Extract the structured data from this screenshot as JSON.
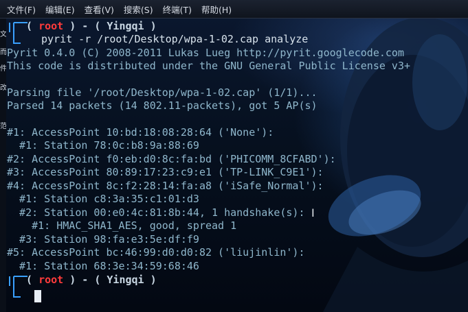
{
  "menu": [
    "文件(F)",
    "编辑(E)",
    "查看(V)",
    "搜索(S)",
    "终端(T)",
    "帮助(H)"
  ],
  "side_glyphs": [
    "文",
    "而",
    "件",
    "改",
    "范"
  ],
  "prompt": {
    "user": "root",
    "sep": " ) - ( ",
    "host": "Yingqi",
    "close": " )"
  },
  "command": "pyrit -r /root/Desktop/wpa-1-02.cap analyze",
  "output": [
    "Pyrit 0.4.0 (C) 2008-2011 Lukas Lueg http://pyrit.googlecode.com",
    "This code is distributed under the GNU General Public License v3+",
    "",
    "Parsing file '/root/Desktop/wpa-1-02.cap' (1/1)...",
    "Parsed 14 packets (14 802.11-packets), got 5 AP(s)",
    "",
    "#1: AccessPoint 10:bd:18:08:28:64 ('None'):",
    "  #1: Station 78:0c:b8:9a:88:69",
    "#2: AccessPoint f0:eb:d0:8c:fa:bd ('PHICOMM_8CFABD'):",
    "#3: AccessPoint 80:89:17:23:c9:e1 ('TP-LINK_C9E1'):",
    "#4: AccessPoint 8c:f2:28:14:fa:a8 ('iSafe_Normal'):",
    "  #1: Station c8:3a:35:c1:01:d3",
    "  #2: Station 00:e0:4c:81:8b:44, 1 handshake(s):",
    "    #1: HMAC_SHA1_AES, good, spread 1",
    "  #3: Station 98:fa:e3:5e:df:f9",
    "#5: AccessPoint bc:46:99:d0:d0:82 ('liujinlin'):",
    "  #1: Station 68:3e:34:59:68:46"
  ],
  "colors": {
    "text": "#8fb7cc",
    "root": "#ff3b3b",
    "prompt": "#c9d7e3",
    "frame": "#3aa0ff",
    "cursor": "#e8eef5"
  },
  "icons": {
    "ibeam": "text-cursor-icon"
  }
}
